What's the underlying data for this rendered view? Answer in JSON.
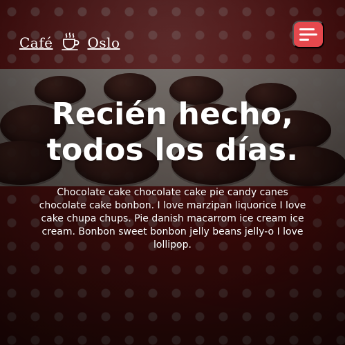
{
  "brand": {
    "name_left": "Café",
    "name_right": "Oslo"
  },
  "header": {
    "menu_icon": "menu-icon"
  },
  "hero": {
    "title_line1": "Recién hecho,",
    "title_line2": "todos los días.",
    "description": "Chocolate cake chocolate cake pie candy canes chocolate cake bonbon. I love marzipan liquorice I love cake chupa chups. Pie danish macarrom ice cream ice cream. Bonbon sweet bonbon jelly beans jelly-o I love lollipop."
  },
  "colors": {
    "menu_button": "#e5484d",
    "text": "#ffffff"
  }
}
